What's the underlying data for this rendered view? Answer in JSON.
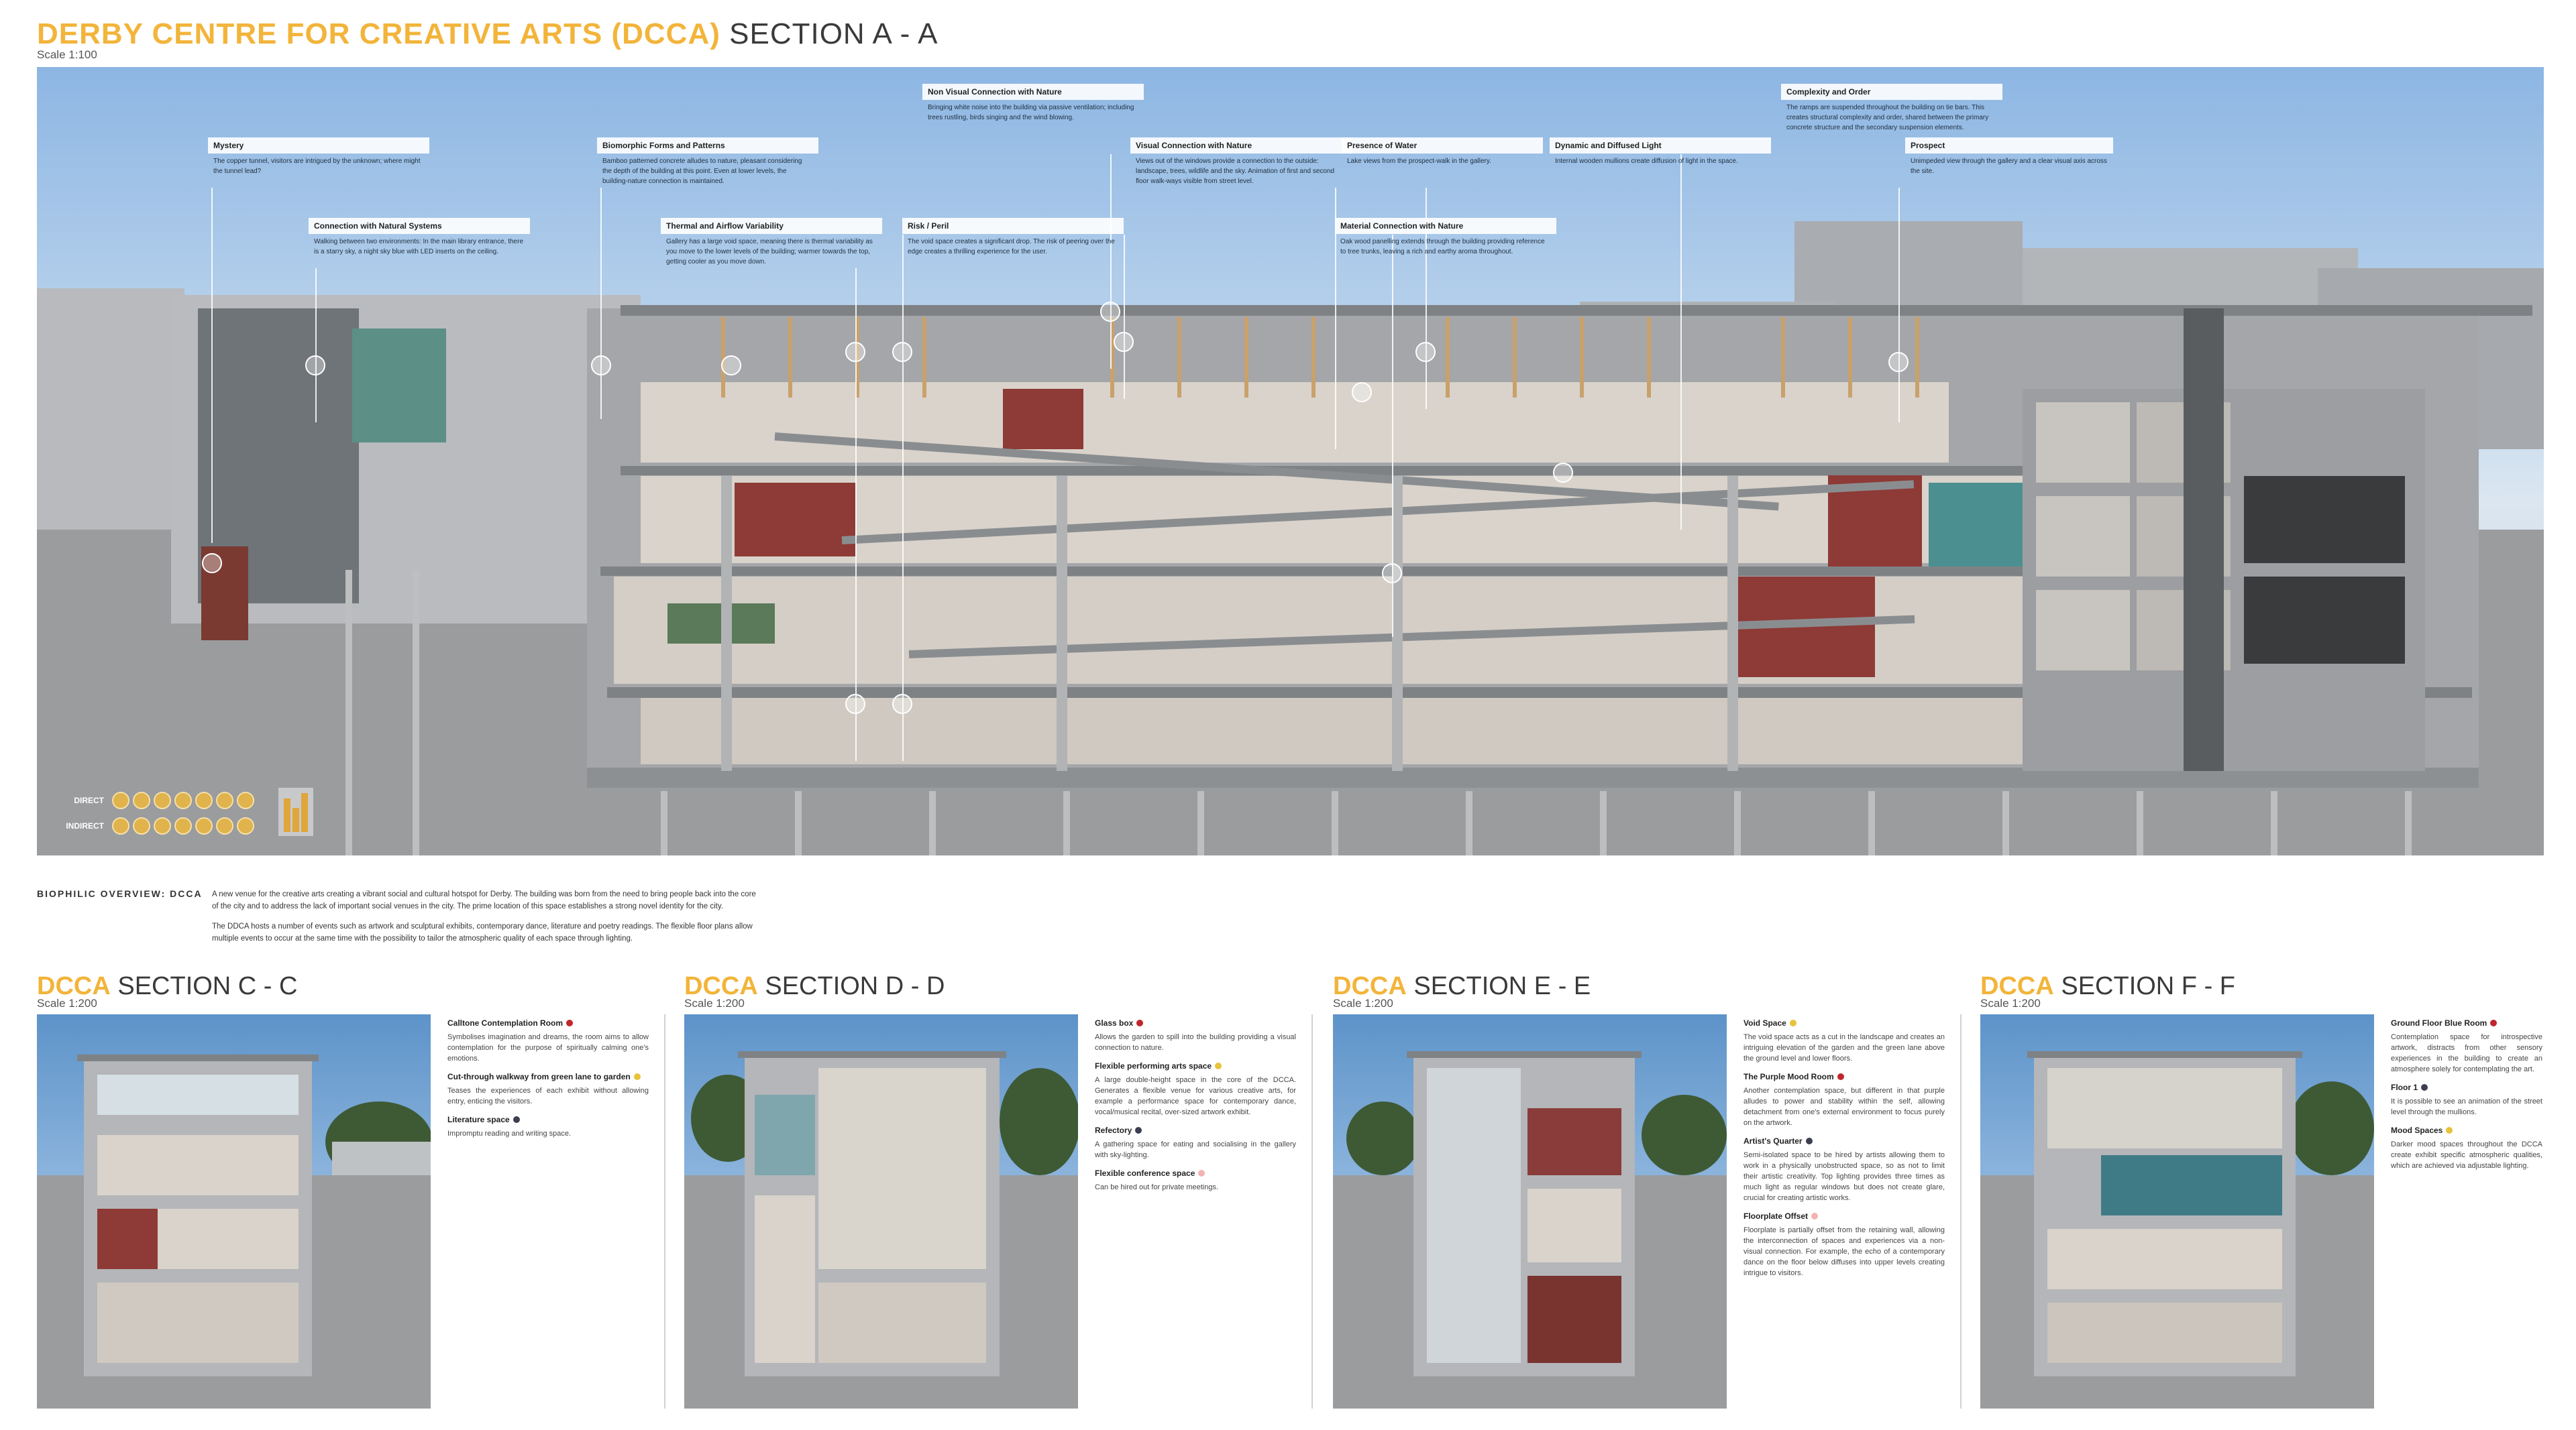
{
  "header": {
    "title_accent": "DERBY CENTRE FOR CREATIVE ARTS (DCCA)",
    "title_plain": "SECTION A - A",
    "scale": "Scale 1:100"
  },
  "annotations": [
    {
      "title": "Mystery",
      "body": "The copper tunnel, visitors are intrigued by the unknown; where might the tunnel lead?"
    },
    {
      "title": "Connection with Natural Systems",
      "body": "Walking between two environments: In the main library entrance, there is a starry sky, a night sky blue with LED inserts on the ceiling."
    },
    {
      "title": "Biomorphic Forms and Patterns",
      "body": "Bamboo patterned concrete alludes to nature, pleasant considering the depth of the building at this point. Even at lower levels, the building-nature connection is maintained."
    },
    {
      "title": "Thermal and Airflow Variability",
      "body": "Gallery has a large void space, meaning there is thermal variability as you move to the lower levels of the building; warmer towards the top, getting cooler as you move down."
    },
    {
      "title": "Non Visual Connection with Nature",
      "body": "Bringing white noise into the building via passive ventilation; including trees rustling, birds singing and the wind blowing."
    },
    {
      "title": "Risk / Peril",
      "body": "The void space creates a significant drop. The risk of peering over the edge creates a thrilling experience for the user."
    },
    {
      "title": "Visual Connection with Nature",
      "body": "Views out of the windows provide a connection to the outside: landscape, trees, wildlife and the sky. Animation of first and second floor walk-ways visible from street level."
    },
    {
      "title": "Presence of Water",
      "body": "Lake views from the prospect-walk in the gallery."
    },
    {
      "title": "Material Connection with Nature",
      "body": "Oak wood panelling extends through the building providing reference to tree trunks, leaving a rich and earthy aroma throughout."
    },
    {
      "title": "Dynamic and Diffused Light",
      "body": "Internal wooden mullions create diffusion of light in the space."
    },
    {
      "title": "Complexity and Order",
      "body": "The ramps are suspended throughout the building on tie bars. This creates structural complexity and order, shared between the primary concrete structure and the secondary suspension elements."
    },
    {
      "title": "Prospect",
      "body": "Unimpeded view through the gallery and a clear visual axis across the site."
    }
  ],
  "legend": {
    "direct_label": "DIRECT",
    "indirect_label": "INDIRECT",
    "accent_color": "#e0b34c"
  },
  "overview": {
    "label": "BIOPHILIC OVERVIEW: DCCA",
    "para1": "A new venue for the creative arts creating a vibrant social and cultural hotspot for Derby. The building was born from the need to bring people back into the core of the city and to address the lack of important social venues in the city. The prime location of this space establishes a strong novel identity for the city.",
    "para2": "The DDCA hosts a number of events such as artwork and sculptural exhibits, contemporary dance, literature and poetry readings. The flexible floor plans allow multiple events to occur at the same time with the possibility to tailor the atmospheric quality of each space through lighting."
  },
  "sections": [
    {
      "title_accent": "DCCA",
      "title_plain": "SECTION C - C",
      "scale": "Scale 1:200",
      "items": [
        {
          "title": "Calltone Contemplation Room",
          "color": "#c0262c",
          "body": "Symbolises imagination and dreams, the room aims to allow contemplation for the purpose of spiritually calming one's emotions."
        },
        {
          "title": "Cut-through walkway from green lane to garden",
          "color": "#e8c23a",
          "body": "Teases the experiences of each exhibit without allowing entry, enticing the visitors."
        },
        {
          "title": "Literature space",
          "color": "#3c3f52",
          "body": "Impromptu reading and writing space."
        }
      ]
    },
    {
      "title_accent": "DCCA",
      "title_plain": "SECTION D - D",
      "scale": "Scale 1:200",
      "items": [
        {
          "title": "Glass box",
          "color": "#c0262c",
          "body": "Allows the garden to spill into the building providing a visual connection to nature."
        },
        {
          "title": "Flexible performing arts space",
          "color": "#e8c23a",
          "body": "A large double-height space in the core of the DCCA. Generates a flexible venue for various creative arts, for example a performance space for contemporary dance, vocal/musical recital, over-sized artwork exhibit."
        },
        {
          "title": "Refectory",
          "color": "#3c3f52",
          "body": "A gathering space for eating and socialising in the gallery with sky-lighting."
        },
        {
          "title": "Flexible conference space",
          "color": "#f2b3b3",
          "body": "Can be hired out for private meetings."
        }
      ]
    },
    {
      "title_accent": "DCCA",
      "title_plain": "SECTION E - E",
      "scale": "Scale 1:200",
      "items": [
        {
          "title": "Void Space",
          "color": "#e8c23a",
          "body": "The void space acts as a cut in the landscape and creates an intriguing elevation of the garden and the green lane above the ground level and lower floors."
        },
        {
          "title": "The Purple Mood Room",
          "color": "#c0262c",
          "body": "Another contemplation space, but different in that purple alludes to power and stability within the self, allowing detachment from one's external environment to focus purely on the artwork."
        },
        {
          "title": "Artist's Quarter",
          "color": "#3c3f52",
          "body": "Semi-isolated space to be hired by artists allowing them to work in a physically unobstructed space, so as not to limit their artistic creativity. Top lighting provides three times as much light as regular windows but does not create glare, crucial for creating artistic works."
        },
        {
          "title": "Floorplate Offset",
          "color": "#f2b3b3",
          "body": "Floorplate is partially offset from the retaining wall, allowing the interconnection of spaces and experiences via a non-visual connection. For example, the echo of a contemporary dance on the floor below diffuses into upper levels creating intrigue to visitors."
        }
      ]
    },
    {
      "title_accent": "DCCA",
      "title_plain": "SECTION F - F",
      "scale": "Scale 1:200",
      "items": [
        {
          "title": "Ground Floor Blue Room",
          "color": "#c0262c",
          "body": "Contemplation space for introspective artwork, distracts from other sensory experiences in the building to create an atmosphere solely for contemplating the art."
        },
        {
          "title": "Floor 1",
          "color": "#3c3f52",
          "body": "It is possible to see an animation of the street level through the mullions."
        },
        {
          "title": "Mood Spaces",
          "color": "#e8c23a",
          "body": "Darker mood spaces throughout the DCCA create exhibit specific atmospheric qualities, which are achieved via adjustable lighting."
        }
      ]
    }
  ]
}
